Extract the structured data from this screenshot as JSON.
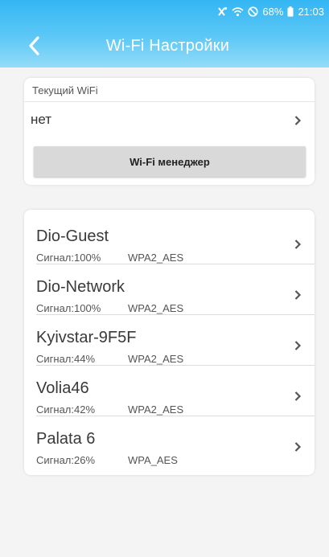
{
  "status_bar": {
    "battery": "68%",
    "time": "21:03",
    "icons": [
      "vibrate-icon",
      "wifi-icon",
      "no-disturb-icon",
      "battery-icon"
    ]
  },
  "header": {
    "title": "Wi-Fi Настройки",
    "back_icon": "back-chevron-icon",
    "color": "#3fb9f4"
  },
  "current_wifi": {
    "label": "Текущий WiFi",
    "value": "нет",
    "manager_button": "Wi-Fi менеджер"
  },
  "networks": [
    {
      "name": "Dio-Guest",
      "signal": "Сигнал:100%",
      "security": "WPA2_AES"
    },
    {
      "name": "Dio-Network",
      "signal": "Сигнал:100%",
      "security": "WPA2_AES"
    },
    {
      "name": "Kyivstar-9F5F",
      "signal": "Сигнал:44%",
      "security": "WPA2_AES"
    },
    {
      "name": "Volia46",
      "signal": "Сигнал:42%",
      "security": "WPA2_AES"
    },
    {
      "name": "Palata 6",
      "signal": "Сигнал:26%",
      "security": "WPA_AES"
    }
  ]
}
